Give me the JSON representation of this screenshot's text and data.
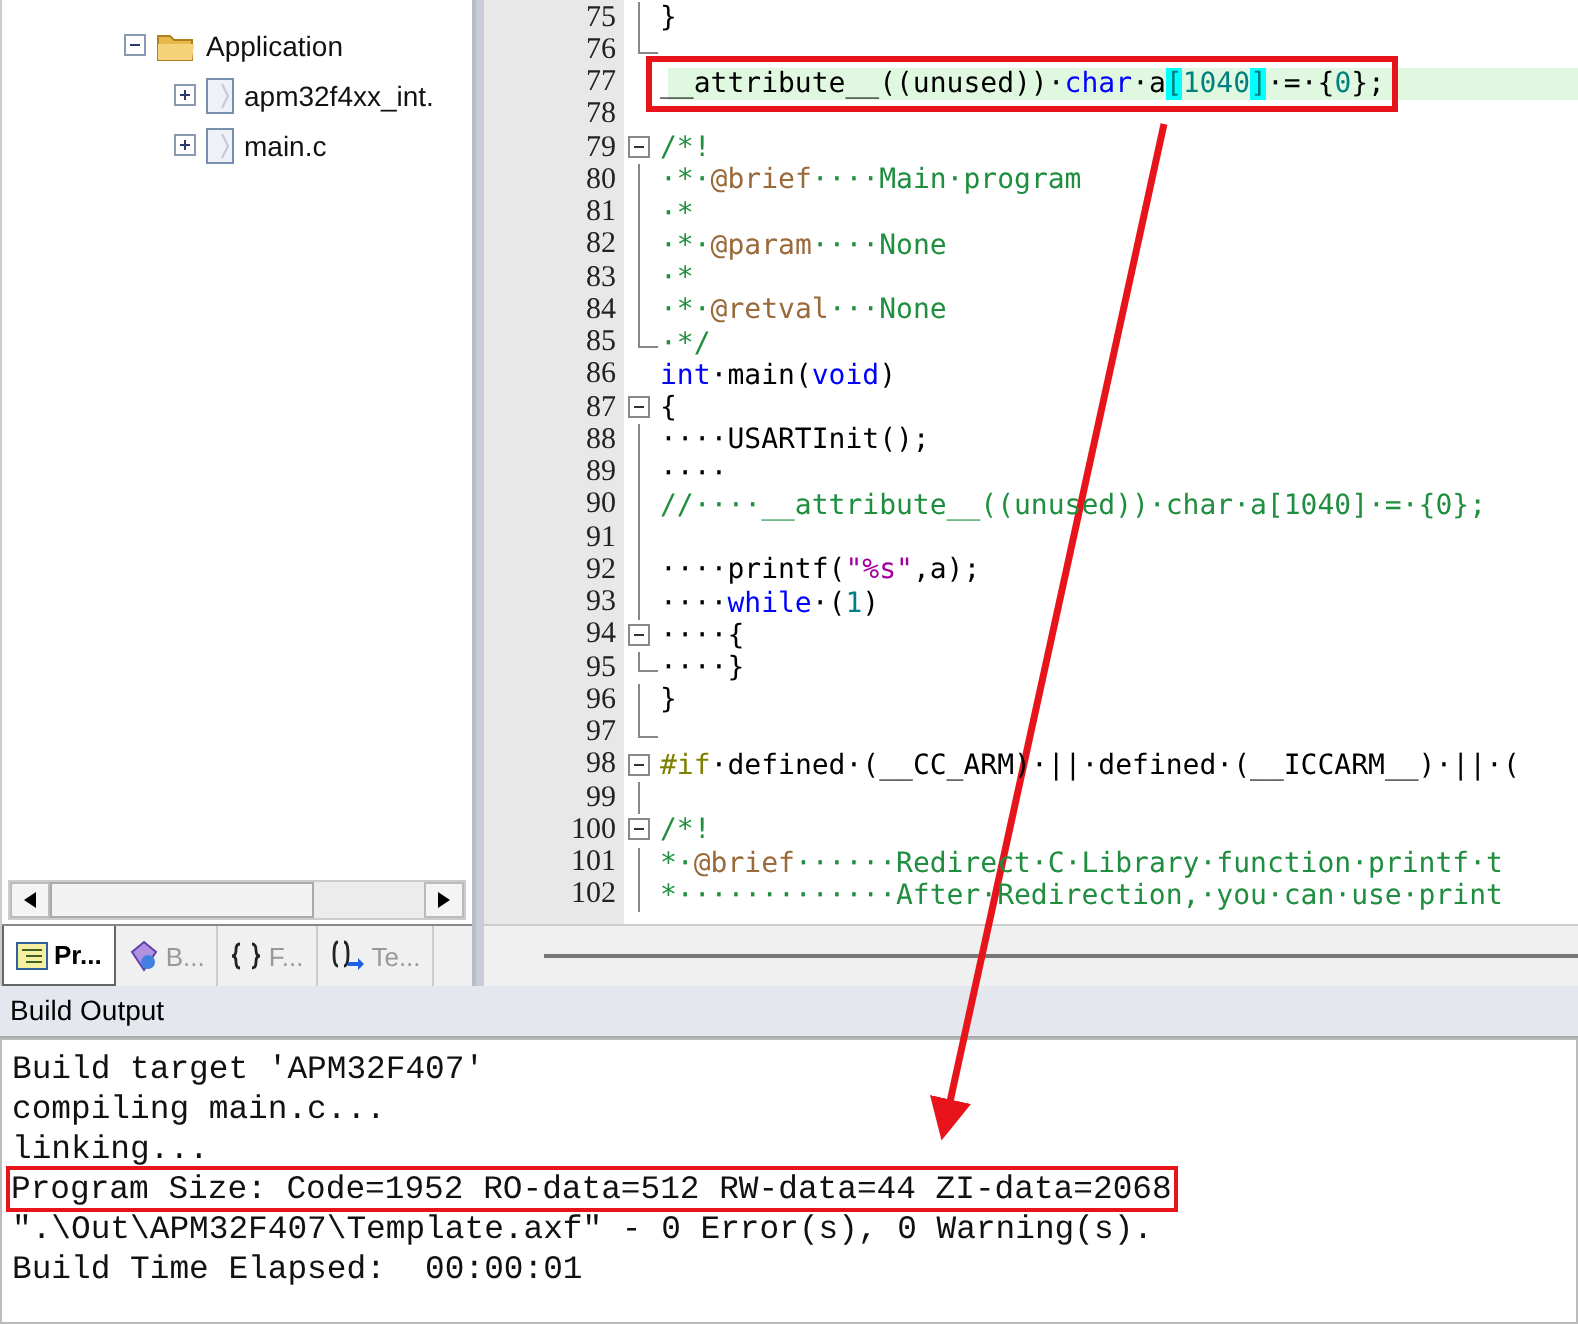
{
  "project_tree": {
    "items": [
      {
        "label": "Application",
        "kind": "folder",
        "expanded": true,
        "children": [
          {
            "label": "apm32f4xx_int.",
            "kind": "file",
            "expanded": false
          },
          {
            "label": "main.c",
            "kind": "file",
            "expanded": false
          }
        ]
      }
    ]
  },
  "panel_tabs": [
    {
      "label": "Pr...",
      "kind": "project",
      "selected": true
    },
    {
      "label": "B...",
      "kind": "books",
      "selected": false
    },
    {
      "label": "F...",
      "kind": "functions",
      "selected": false
    },
    {
      "label": "Te...",
      "kind": "templates",
      "selected": false
    }
  ],
  "editor": {
    "lines": [
      {
        "number": "75",
        "fold_guide": true,
        "segments": [
          {
            "kind": "plain",
            "text": "}"
          }
        ]
      },
      {
        "number": "76",
        "fold_end": true
      },
      {
        "number": "77",
        "highlighted": true,
        "annotated": true,
        "segments": [
          {
            "kind": "plain",
            "text": "__attribute__((unused))·"
          },
          {
            "kind": "keyword",
            "text": "char"
          },
          {
            "kind": "plain",
            "text": "·a"
          },
          {
            "kind": "bracket",
            "text": "["
          },
          {
            "kind": "number",
            "text": "1040"
          },
          {
            "kind": "bracket",
            "text": "]"
          },
          {
            "kind": "plain",
            "text": "·=·{"
          },
          {
            "kind": "number",
            "text": "0"
          },
          {
            "kind": "plain",
            "text": "};"
          }
        ]
      },
      {
        "number": "78"
      },
      {
        "number": "79",
        "collapsible": true,
        "segments": [
          {
            "kind": "comment",
            "text": "/*!"
          }
        ]
      },
      {
        "number": "80",
        "fold_guide": true,
        "segments": [
          {
            "kind": "comment",
            "text": "·*·"
          },
          {
            "kind": "doctag",
            "text": "@brief"
          },
          {
            "kind": "comment",
            "text": "····Main·program"
          }
        ]
      },
      {
        "number": "81",
        "fold_guide": true,
        "segments": [
          {
            "kind": "comment",
            "text": "·*"
          }
        ]
      },
      {
        "number": "82",
        "fold_guide": true,
        "segments": [
          {
            "kind": "comment",
            "text": "·*·"
          },
          {
            "kind": "doctag",
            "text": "@param"
          },
          {
            "kind": "comment",
            "text": "····None"
          }
        ]
      },
      {
        "number": "83",
        "fold_guide": true,
        "segments": [
          {
            "kind": "comment",
            "text": "·*"
          }
        ]
      },
      {
        "number": "84",
        "fold_guide": true,
        "segments": [
          {
            "kind": "comment",
            "text": "·*·"
          },
          {
            "kind": "doctag",
            "text": "@retval"
          },
          {
            "kind": "comment",
            "text": "···None"
          }
        ]
      },
      {
        "number": "85",
        "fold_end": true,
        "segments": [
          {
            "kind": "comment",
            "text": "·*/"
          }
        ]
      },
      {
        "number": "86",
        "segments": [
          {
            "kind": "keyword",
            "text": "int"
          },
          {
            "kind": "plain",
            "text": "·main("
          },
          {
            "kind": "keyword",
            "text": "void"
          },
          {
            "kind": "plain",
            "text": ")"
          }
        ]
      },
      {
        "number": "87",
        "collapsible": true,
        "segments": [
          {
            "kind": "plain",
            "text": "{"
          }
        ]
      },
      {
        "number": "88",
        "fold_guide": true,
        "segments": [
          {
            "kind": "plain",
            "text": "····USARTInit();"
          }
        ]
      },
      {
        "number": "89",
        "fold_guide": true,
        "segments": [
          {
            "kind": "plain",
            "text": "····"
          }
        ]
      },
      {
        "number": "90",
        "fold_guide": true,
        "segments": [
          {
            "kind": "comment",
            "text": "//····__attribute__((unused))·char·a[1040]·=·{0};"
          }
        ]
      },
      {
        "number": "91",
        "fold_guide": true
      },
      {
        "number": "92",
        "fold_guide": true,
        "segments": [
          {
            "kind": "plain",
            "text": "····printf("
          },
          {
            "kind": "string",
            "text": "\"%s\""
          },
          {
            "kind": "plain",
            "text": ",a);"
          }
        ]
      },
      {
        "number": "93",
        "fold_guide": true,
        "segments": [
          {
            "kind": "plain",
            "text": "····"
          },
          {
            "kind": "keyword",
            "text": "while"
          },
          {
            "kind": "plain",
            "text": "·("
          },
          {
            "kind": "number",
            "text": "1"
          },
          {
            "kind": "plain",
            "text": ")"
          }
        ]
      },
      {
        "number": "94",
        "collapsible": true,
        "segments": [
          {
            "kind": "plain",
            "text": "····{"
          }
        ]
      },
      {
        "number": "95",
        "fold_end": true,
        "segments": [
          {
            "kind": "plain",
            "text": "····}"
          }
        ]
      },
      {
        "number": "96",
        "fold_guide": true,
        "segments": [
          {
            "kind": "plain",
            "text": "}"
          }
        ]
      },
      {
        "number": "97",
        "fold_end": true
      },
      {
        "number": "98",
        "collapsible": true,
        "segments": [
          {
            "kind": "preproc",
            "text": "#if"
          },
          {
            "kind": "plain",
            "text": "·defined·(__CC_ARM)·||·defined·(__ICCARM__)·||·("
          }
        ]
      },
      {
        "number": "99",
        "fold_guide": true
      },
      {
        "number": "100",
        "collapsible": true,
        "segments": [
          {
            "kind": "comment",
            "text": "/*!"
          }
        ]
      },
      {
        "number": "101",
        "fold_guide": true,
        "segments": [
          {
            "kind": "comment",
            "text": "*·"
          },
          {
            "kind": "doctag",
            "text": "@brief"
          },
          {
            "kind": "comment",
            "text": "······Redirect·C·Library·function·printf·t"
          }
        ]
      },
      {
        "number": "102",
        "fold_guide": true,
        "segments": [
          {
            "kind": "comment",
            "text": "*·············After·Redirection,·you·can·use·print"
          }
        ]
      }
    ]
  },
  "build_output": {
    "title": "Build Output",
    "lines": [
      {
        "text": "Build target 'APM32F407'",
        "annotated": false
      },
      {
        "text": "compiling main.c...",
        "annotated": false
      },
      {
        "text": "linking...",
        "annotated": false
      },
      {
        "text": "Program Size: Code=1952 RO-data=512 RW-data=44 ZI-data=2068",
        "annotated": true
      },
      {
        "text": "\".\\Out\\APM32F407\\Template.axf\" - 0 Error(s), 0 Warning(s).",
        "annotated": false
      },
      {
        "text": "Build Time Elapsed:  00:00:01",
        "annotated": false
      }
    ]
  }
}
